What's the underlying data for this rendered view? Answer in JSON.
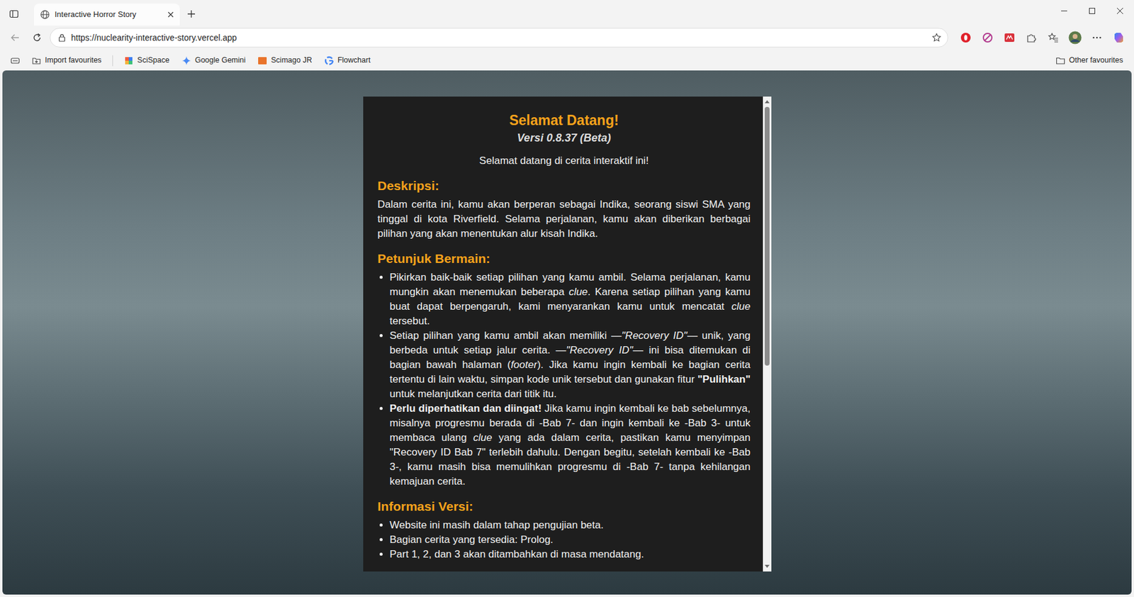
{
  "browser": {
    "tabs": [
      {
        "label": "Interactive Horror Story",
        "selected": true
      }
    ],
    "address": "https://nuclearity-interactive-story.vercel.app",
    "bookmarked": false,
    "favourites": [
      {
        "label": "Import favourites"
      },
      {
        "label": "SciSpace"
      },
      {
        "label": "Google Gemini"
      },
      {
        "label": "Scimago JR"
      },
      {
        "label": "Flowchart"
      }
    ],
    "other_favourites": "Other favourites"
  },
  "panel": {
    "title": "Selamat Datang!",
    "version": "Versi 0.8.37 (Beta)",
    "welcome": "Selamat datang di cerita interaktif ini!",
    "sections": [
      {
        "heading": "Deskripsi:",
        "kind": "paragraph",
        "blocks": [
          [
            {
              "text": "Dalam cerita ini, kamu akan berperan sebagai Indika, seorang siswi SMA yang tinggal di kota Riverfield. Selama perjalanan, kamu akan diberikan berbagai pilihan yang akan menentukan alur kisah Indika.",
              "kind": "normal"
            }
          ]
        ]
      },
      {
        "heading": "Petunjuk Bermain:",
        "kind": "list",
        "blocks": [
          [
            {
              "text": "Pikirkan baik-baik setiap pilihan yang kamu ambil. Selama perjalanan, kamu mungkin akan menemukan beberapa ",
              "kind": "normal"
            },
            {
              "text": "clue",
              "kind": "italic"
            },
            {
              "text": ". Karena setiap pilihan yang kamu buat dapat berpengaruh, kami menyarankan kamu untuk mencatat ",
              "kind": "normal"
            },
            {
              "text": "clue",
              "kind": "italic"
            },
            {
              "text": " tersebut.",
              "kind": "normal"
            }
          ],
          [
            {
              "text": "Setiap pilihan yang kamu ambil akan memiliki —",
              "kind": "normal"
            },
            {
              "text": "\"Recovery ID\"",
              "kind": "italic"
            },
            {
              "text": "— unik, yang berbeda untuk setiap jalur cerita. —",
              "kind": "normal"
            },
            {
              "text": "\"Recovery ID\"",
              "kind": "italic"
            },
            {
              "text": "— ini bisa ditemukan di bagian bawah halaman (",
              "kind": "normal"
            },
            {
              "text": "footer",
              "kind": "italic"
            },
            {
              "text": "). Jika kamu ingin kembali ke bagian cerita tertentu di lain waktu, simpan kode unik tersebut dan gunakan fitur ",
              "kind": "normal"
            },
            {
              "text": "\"Pulihkan\"",
              "kind": "bold"
            },
            {
              "text": " untuk melanjutkan cerita dari titik itu.",
              "kind": "normal"
            }
          ],
          [
            {
              "text": "Perlu diperhatikan dan diingat!",
              "kind": "bold"
            },
            {
              "text": " Jika kamu ingin kembali ke bab sebelumnya, misalnya progresmu berada di -Bab 7- dan ingin kembali ke -Bab 3- untuk membaca ulang ",
              "kind": "normal"
            },
            {
              "text": "clue",
              "kind": "italic"
            },
            {
              "text": " yang ada dalam cerita, pastikan kamu menyimpan \"Recovery ID Bab 7\" terlebih dahulu. Dengan begitu, setelah kembali ke -Bab 3-, kamu masih bisa memulihkan progresmu di -Bab 7- tanpa kehilangan kemajuan cerita.",
              "kind": "normal"
            }
          ]
        ]
      },
      {
        "heading": "Informasi Versi:",
        "kind": "list",
        "blocks": [
          [
            {
              "text": "Website ini masih dalam tahap pengujian beta.",
              "kind": "normal"
            }
          ],
          [
            {
              "text": "Bagian cerita yang tersedia: Prolog.",
              "kind": "normal"
            }
          ],
          [
            {
              "text": "Part 1, 2, dan 3 akan ditambahkan di masa mendatang.",
              "kind": "normal"
            }
          ]
        ]
      }
    ],
    "scrollbar": {
      "level": 0.57
    }
  }
}
